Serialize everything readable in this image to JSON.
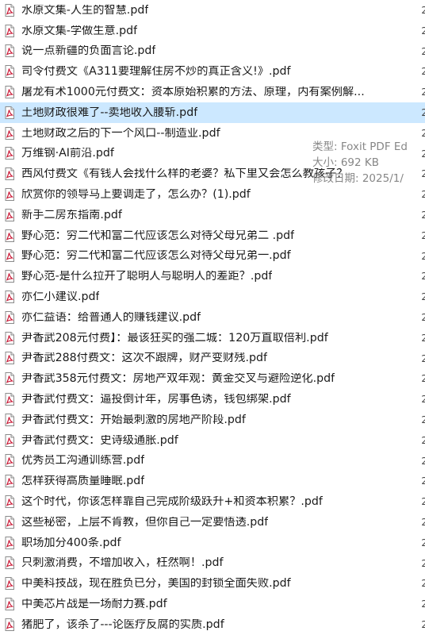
{
  "files": [
    {
      "name": "水原文集-人生的智慧.pdf"
    },
    {
      "name": "水原文集-学做生意.pdf"
    },
    {
      "name": "说一点新疆的负面言论.pdf"
    },
    {
      "name": "司令付费文《A311要理解住房不炒的真正含义!》.pdf"
    },
    {
      "name": "屠龙有术1000元付费文：资本原始积累的方法、原理，内有案例解..."
    },
    {
      "name": "土地财政很难了--卖地收入腰斩.pdf",
      "selected": true
    },
    {
      "name": "土地财政之后的下一个风口--制造业.pdf"
    },
    {
      "name": "万维钢·AI前沿.pdf"
    },
    {
      "name": "西风付费文《有钱人会找什么样的老婆？私下里又会怎么教孩子？"
    },
    {
      "name": "欣赏你的领导马上要调走了，怎么办？(1).pdf"
    },
    {
      "name": "新手二房东指南.pdf"
    },
    {
      "name": "野心范：穷二代和富二代应该怎么对待父母兄弟二 .pdf"
    },
    {
      "name": "野心范：穷二代和富二代应该怎么对待父母兄弟一.pdf"
    },
    {
      "name": "野心范-是什么拉开了聪明人与聪明人的差距？.pdf"
    },
    {
      "name": "亦仁小建议.pdf"
    },
    {
      "name": "亦仁益语：给普通人的赚钱建议.pdf"
    },
    {
      "name": "尹香武208元付费】：最该狂买的强二城：120万直取倍利.pdf"
    },
    {
      "name": "尹香武288付费文：这次不跟牌，财产变财残.pdf"
    },
    {
      "name": "尹香武358元付费文：房地产双年观：黄金交叉与避险逆化.pdf"
    },
    {
      "name": "尹香武付费文：逼投倒计年，房事色诱，钱包绑架.pdf"
    },
    {
      "name": "尹香武付费文：开始最刺激的房地产阶段.pdf"
    },
    {
      "name": "尹香武付费文：史诗级通胀.pdf"
    },
    {
      "name": "优秀员工沟通训练营.pdf"
    },
    {
      "name": "怎样获得高质量睡眠.pdf"
    },
    {
      "name": "这个时代，你该怎样靠自己完成阶级跃升+和资本积累？.pdf"
    },
    {
      "name": "这些秘密，上层不肯教，但你自己一定要悟透.pdf"
    },
    {
      "name": "职场加分400条.pdf"
    },
    {
      "name": "只刺激消费，不增加收入，枉然啊！.pdf"
    },
    {
      "name": "中美科技战，现在胜负已分，美国的封锁全面失败.pdf"
    },
    {
      "name": "中美芯片战是一场耐力赛.pdf"
    },
    {
      "name": "猪肥了，该杀了---论医疗反腐的实质.pdf"
    }
  ],
  "tooltip": {
    "type_line": "类型: Foxit PDF Ed",
    "size_line": "大小: 692 KB",
    "modified_line": "修改日期: 2025/1/"
  },
  "edge_char": "2",
  "colors": {
    "selected_bg": "#cce8ff",
    "icon_accent": "#c8102e"
  },
  "icons": {
    "file": "pdf-file-icon"
  }
}
